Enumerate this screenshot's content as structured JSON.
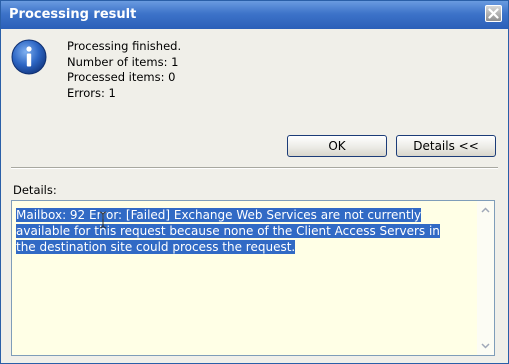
{
  "window": {
    "title": "Processing result"
  },
  "message": {
    "line1": "Processing finished.",
    "line2": "Number of items: 1",
    "line3": "Processed items: 0",
    "line4": "Errors: 1"
  },
  "buttons": {
    "ok_label": "OK",
    "details_label": "Details <<"
  },
  "details": {
    "label": "Details:",
    "text": "Mailbox: 92 Error: [Failed] Exchange Web Services are not currently available for this request because none of the Client Access Servers in the destination site could process the request."
  },
  "icons": {
    "info": "info-icon",
    "close": "close-icon",
    "scroll_up": "chevron-up-icon",
    "scroll_down": "chevron-down-icon",
    "cursor": "text-cursor-icon"
  },
  "colors": {
    "titlebar": "#3d73c9",
    "selection": "#316ac5",
    "details_background": "#ffffe6",
    "info_icon": "#2158b8"
  }
}
